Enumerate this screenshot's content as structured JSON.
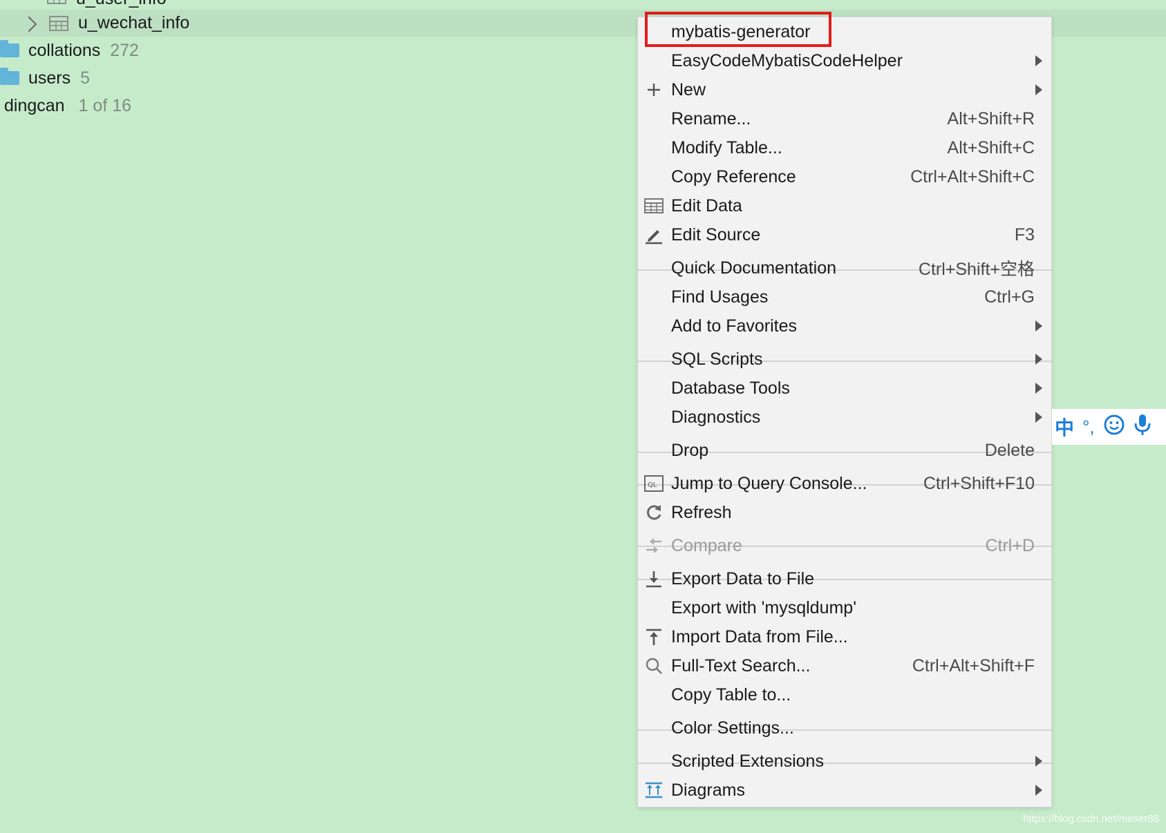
{
  "tree": {
    "top_partial_label": "u_user_info",
    "selected_item": "u_wechat_info",
    "items": [
      {
        "label": "collations",
        "count": "272"
      },
      {
        "label": "users",
        "count": "5"
      }
    ],
    "schema": {
      "label": "dingcan",
      "count": "1 of 16"
    }
  },
  "context_menu": {
    "items": [
      {
        "label": "mybatis-generator",
        "shortcut": "",
        "icon": "",
        "submenu": false,
        "disabled": false
      },
      {
        "label": "EasyCodeMybatisCodeHelper",
        "shortcut": "",
        "icon": "",
        "submenu": true,
        "disabled": false
      },
      {
        "label": "New",
        "shortcut": "",
        "icon": "plus-icon",
        "submenu": true,
        "disabled": false
      },
      {
        "label": "Rename...",
        "shortcut": "Alt+Shift+R",
        "icon": "",
        "submenu": false,
        "disabled": false
      },
      {
        "label": "Modify Table...",
        "shortcut": "Alt+Shift+C",
        "icon": "",
        "submenu": false,
        "disabled": false
      },
      {
        "label": "Copy Reference",
        "shortcut": "Ctrl+Alt+Shift+C",
        "icon": "",
        "submenu": false,
        "disabled": false
      },
      {
        "label": "Edit Data",
        "shortcut": "",
        "icon": "table-grid-icon",
        "submenu": false,
        "disabled": false
      },
      {
        "label": "Edit Source",
        "shortcut": "F3",
        "icon": "pencil-icon",
        "submenu": false,
        "disabled": false
      },
      {
        "label": "Quick Documentation",
        "shortcut": "Ctrl+Shift+空格",
        "icon": "",
        "submenu": false,
        "disabled": false
      },
      {
        "label": "Find Usages",
        "shortcut": "Ctrl+G",
        "icon": "",
        "submenu": false,
        "disabled": false
      },
      {
        "label": "Add to Favorites",
        "shortcut": "",
        "icon": "",
        "submenu": true,
        "disabled": false
      },
      {
        "label": "SQL Scripts",
        "shortcut": "",
        "icon": "",
        "submenu": true,
        "disabled": false
      },
      {
        "label": "Database Tools",
        "shortcut": "",
        "icon": "",
        "submenu": true,
        "disabled": false
      },
      {
        "label": "Diagnostics",
        "shortcut": "",
        "icon": "",
        "submenu": true,
        "disabled": false
      },
      {
        "label": "Drop",
        "shortcut": "Delete",
        "icon": "",
        "submenu": false,
        "disabled": false
      },
      {
        "label": "Jump to Query Console...",
        "shortcut": "Ctrl+Shift+F10",
        "icon": "query-console-icon",
        "submenu": false,
        "disabled": false
      },
      {
        "label": "Refresh",
        "shortcut": "",
        "icon": "refresh-icon",
        "submenu": false,
        "disabled": false
      },
      {
        "label": "Compare",
        "shortcut": "Ctrl+D",
        "icon": "compare-icon",
        "submenu": false,
        "disabled": true
      },
      {
        "label": "Export Data to File",
        "shortcut": "",
        "icon": "download-icon",
        "submenu": false,
        "disabled": false
      },
      {
        "label": "Export with 'mysqldump'",
        "shortcut": "",
        "icon": "",
        "submenu": false,
        "disabled": false
      },
      {
        "label": "Import Data from File...",
        "shortcut": "",
        "icon": "upload-icon",
        "submenu": false,
        "disabled": false
      },
      {
        "label": "Full-Text Search...",
        "shortcut": "Ctrl+Alt+Shift+F",
        "icon": "search-icon",
        "submenu": false,
        "disabled": false
      },
      {
        "label": "Copy Table to...",
        "shortcut": "",
        "icon": "",
        "submenu": false,
        "disabled": false
      },
      {
        "label": "Color Settings...",
        "shortcut": "",
        "icon": "",
        "submenu": false,
        "disabled": false
      },
      {
        "label": "Scripted Extensions",
        "shortcut": "",
        "icon": "",
        "submenu": true,
        "disabled": false
      },
      {
        "label": "Diagrams",
        "shortcut": "",
        "icon": "diagram-icon",
        "submenu": true,
        "disabled": false
      }
    ]
  },
  "ime_toolbar": {
    "mode_label": "中",
    "punct_label": "°,"
  },
  "watermark": "https://blog.csdn.net/meser88",
  "colors": {
    "background": "#c6ebcb",
    "menu_bg": "#f2f2f2",
    "highlight_border": "#e51b1b",
    "ime_blue": "#1e7fd8"
  }
}
